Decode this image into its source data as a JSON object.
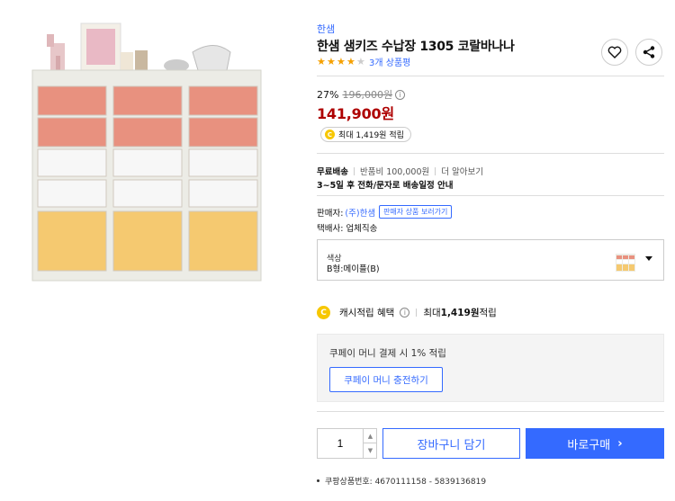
{
  "brand": "한샘",
  "title": "한샘 샘키즈 수납장 1305 코랄바나나",
  "rating": {
    "stars": 4,
    "max": 5,
    "review_text": "3개 상품평"
  },
  "price": {
    "discount_rate": "27%",
    "original": "196,000원",
    "sale": "141,900원",
    "cash_reward": "최대 1,419원 적립"
  },
  "shipping": {
    "free": "무료배송",
    "return_fee": "반품비 100,000원",
    "more": "더 알아보기",
    "schedule": "3~5일 후 전화/문자로 배송일정 안내"
  },
  "seller": {
    "label": "판매자:",
    "name": "(주)한샘",
    "more_button": "판매자 상품 보러가기",
    "delivery": "택배사: 업체직송"
  },
  "option": {
    "label": "색상",
    "value": "B형:메이플(B)"
  },
  "cash_benefit": {
    "label": "캐시적립 혜택",
    "detail_prefix": "최대 ",
    "amount": "1,419원",
    "detail_suffix": " 적립"
  },
  "coupay": {
    "text": "쿠페이 머니 결제 시 1% 적립",
    "button": "쿠페이 머니 충전하기"
  },
  "quantity": "1",
  "buttons": {
    "cart": "장바구니 담기",
    "buy": "바로구매"
  },
  "product_number": "쿠팡상품번호: 4670111158 - 5839136819",
  "colors": {
    "accent": "#346aff",
    "price": "#ae0000",
    "star": "#f5a000",
    "coin": "#f7c700"
  },
  "icons": {
    "wish": "heart-icon",
    "share": "share-icon",
    "info": "info-icon",
    "coin": "coin-icon"
  }
}
